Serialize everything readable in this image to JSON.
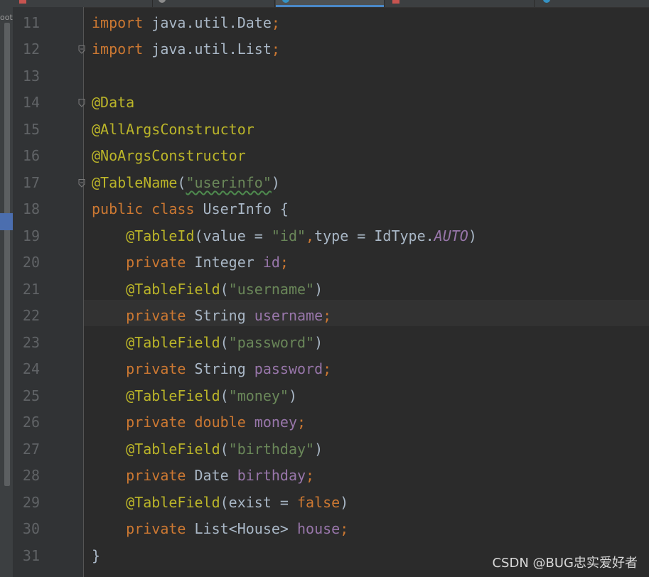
{
  "editor": {
    "sidebar_partial_label": "oot",
    "watermark": "CSDN @BUG忠实爱好者",
    "line_numbers": [
      "11",
      "12",
      "13",
      "14",
      "15",
      "16",
      "17",
      "18",
      "19",
      "20",
      "21",
      "22",
      "23",
      "24",
      "25",
      "26",
      "27",
      "28",
      "29",
      "30",
      "31"
    ],
    "current_line_number": "22",
    "code": {
      "l11": {
        "t0": "import",
        "t1": " java.util.Date",
        "t2": ";"
      },
      "l12": {
        "t0": "import",
        "t1": " java.util.List",
        "t2": ";"
      },
      "l14": {
        "t0": "@Data"
      },
      "l15": {
        "t0": "@AllArgsConstructor"
      },
      "l16": {
        "t0": "@NoArgsConstructor"
      },
      "l17": {
        "t0": "@TableName",
        "t1": "(",
        "t2": "\"userinfo\"",
        "t3": ")"
      },
      "l18": {
        "t0": "public class ",
        "t1": "UserInfo {"
      },
      "l19": {
        "t0": "@TableId",
        "t1": "(value = ",
        "t2": "\"id\"",
        "t3": ",",
        "t4": "type = IdType.",
        "t5": "AUTO",
        "t6": ")"
      },
      "l20": {
        "t0": "private ",
        "t1": "Integer ",
        "t2": "id",
        "t3": ";"
      },
      "l21": {
        "t0": "@TableField",
        "t1": "(",
        "t2": "\"username\"",
        "t3": ")"
      },
      "l22": {
        "t0": "private ",
        "t1": "String ",
        "t2": "username",
        "t3": ";"
      },
      "l23": {
        "t0": "@TableField",
        "t1": "(",
        "t2": "\"password\"",
        "t3": ")"
      },
      "l24": {
        "t0": "private ",
        "t1": "String ",
        "t2": "password",
        "t3": ";"
      },
      "l25": {
        "t0": "@TableField",
        "t1": "(",
        "t2": "\"money\"",
        "t3": ")"
      },
      "l26": {
        "t0": "private ",
        "t1": "double ",
        "t2": "money",
        "t3": ";"
      },
      "l27": {
        "t0": "@TableField",
        "t1": "(",
        "t2": "\"birthday\"",
        "t3": ")"
      },
      "l28": {
        "t0": "private ",
        "t1": "Date ",
        "t2": "birthday",
        "t3": ";"
      },
      "l29": {
        "t0": "@TableField",
        "t1": "(exist = ",
        "t2": "false",
        "t3": ")"
      },
      "l30": {
        "t0": "private ",
        "t1": "List<House> ",
        "t2": "house",
        "t3": ";"
      },
      "l31": {
        "t0": "}"
      }
    },
    "colors": {
      "background": "#2b2b2b",
      "gutter": "#313335",
      "keyword": "#cc7832",
      "annotation": "#bbb529",
      "string": "#6a8759",
      "field": "#9876aa",
      "plain": "#a9b7c6",
      "line_number": "#606366",
      "active_tab_underline": "#4a88c7"
    }
  }
}
